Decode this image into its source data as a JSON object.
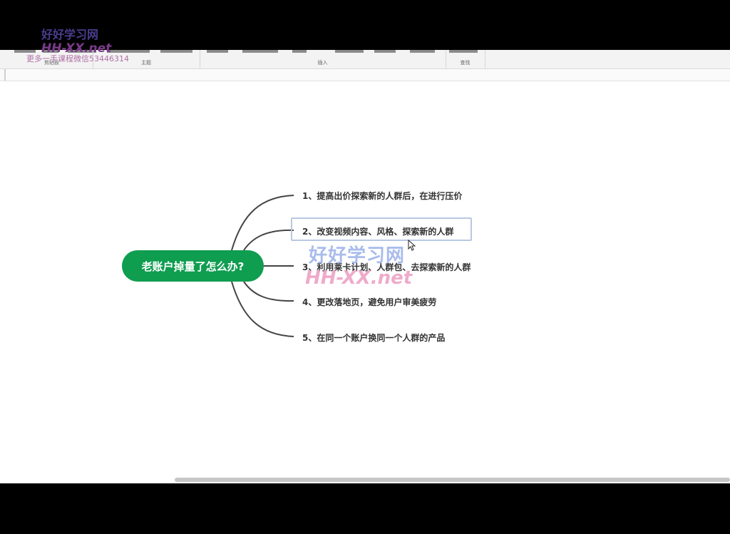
{
  "ribbon": {
    "groups": [
      "剪贴板",
      "主题",
      "插入",
      "查找"
    ]
  },
  "mindmap": {
    "root": "老账户掉量了怎么办?",
    "branches": [
      "1、提高出价探索新的人群后，在进行压价",
      "2、改变视频内容、风格、探索新的人群",
      "3、利用莱卡计划、人群包、去探索新的人群",
      "4、更改落地页，避免用户审美疲劳",
      "5、在同一个账户换同一个人群的产品"
    ],
    "root_color": "#0f9d50",
    "line_color": "#444444"
  },
  "watermark": {
    "site_cn": "好好学习网",
    "site_en": "HH-XX.net",
    "promo": "更多一手课程微信53446314"
  }
}
